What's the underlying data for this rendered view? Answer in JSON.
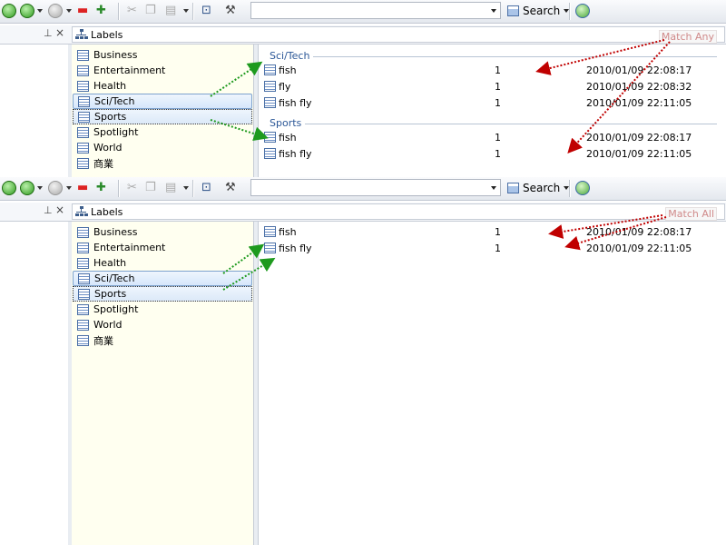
{
  "panels": [
    {
      "match_label": "Match Any",
      "search_label": "Search",
      "header_title": "Labels",
      "labels": [
        "Business",
        "Entertainment",
        "Health",
        "Sci/Tech",
        "Sports",
        "Spotlight",
        "World",
        "商業"
      ],
      "groups": [
        {
          "title": "Sci/Tech",
          "rows": [
            {
              "name": "fish",
              "count": "1",
              "date": "2010/01/09 22:08:17"
            },
            {
              "name": "fly",
              "count": "1",
              "date": "2010/01/09 22:08:32"
            },
            {
              "name": "fish fly",
              "count": "1",
              "date": "2010/01/09 22:11:05"
            }
          ]
        },
        {
          "title": "Sports",
          "rows": [
            {
              "name": "fish",
              "count": "1",
              "date": "2010/01/09 22:08:17"
            },
            {
              "name": "fish fly",
              "count": "1",
              "date": "2010/01/09 22:11:05"
            }
          ]
        }
      ]
    },
    {
      "match_label": "Match All",
      "search_label": "Search",
      "header_title": "Labels",
      "labels": [
        "Business",
        "Entertainment",
        "Health",
        "Sci/Tech",
        "Sports",
        "Spotlight",
        "World",
        "商業"
      ],
      "rows": [
        {
          "name": "fish",
          "count": "1",
          "date": "2010/01/09 22:08:17"
        },
        {
          "name": "fish fly",
          "count": "1",
          "date": "2010/01/09 22:11:05"
        }
      ]
    }
  ],
  "colors": {
    "annotation_green": "#1e9a1e",
    "annotation_red": "#c00000",
    "group_title": "#2b5797"
  },
  "icons": {
    "toolbar": [
      "add-icon",
      "forward-icon",
      "back-icon",
      "remove-icon",
      "insert-icon",
      "cut-icon",
      "copy-icon",
      "print-icon",
      "fit-icon",
      "tools-icon",
      "refresh-icon"
    ]
  }
}
